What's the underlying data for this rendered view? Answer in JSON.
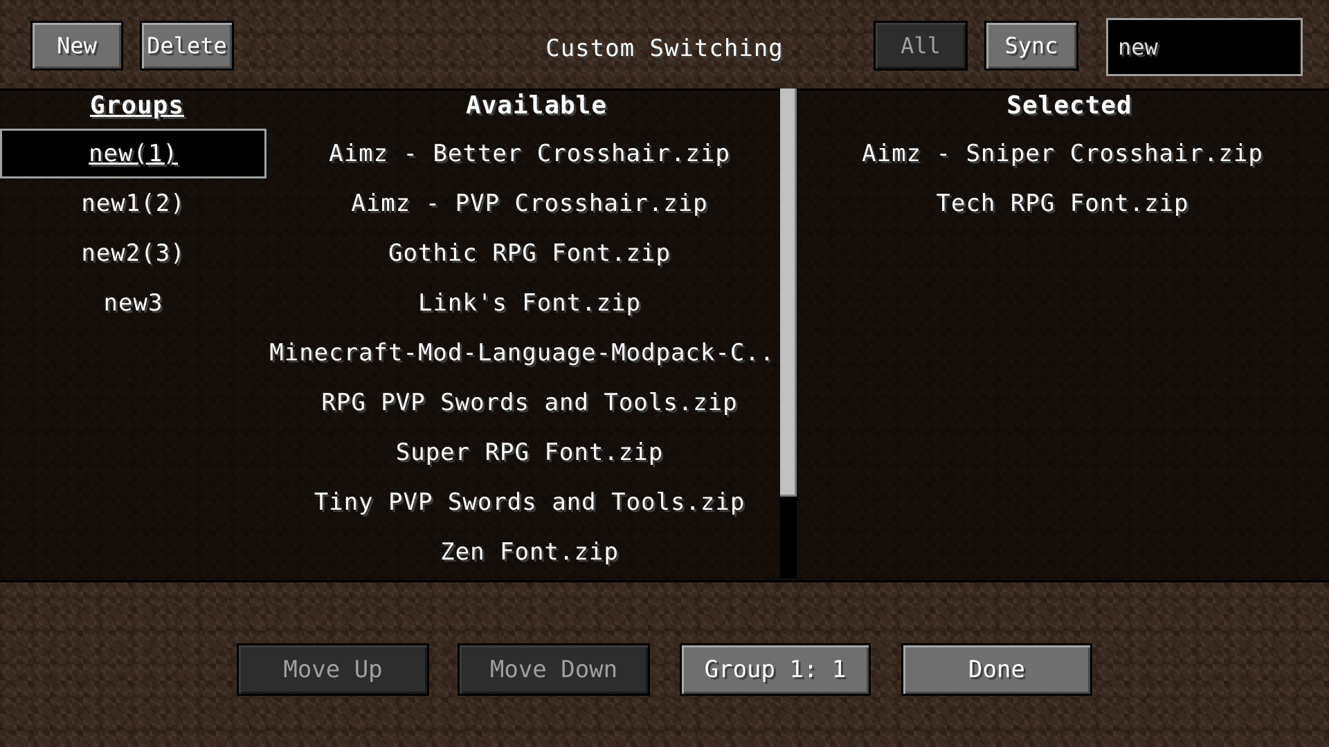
{
  "header": {
    "title": "Custom Switching",
    "new_label": "New",
    "delete_label": "Delete",
    "all_label": "All",
    "sync_label": "Sync",
    "search_value": "new"
  },
  "groups": {
    "header": "Groups",
    "items": [
      "new(1)",
      "new1(2)",
      "new2(3)",
      "new3"
    ],
    "selected_index": 0
  },
  "available": {
    "header": "Available",
    "items": [
      "Aimz - Better Crosshair.zip",
      "Aimz - PVP Crosshair.zip",
      "Gothic RPG Font.zip",
      "Link's Font.zip",
      "Minecraft-Mod-Language-Modpack-C...",
      "RPG PVP Swords and Tools.zip",
      "Super RPG Font.zip",
      "Tiny PVP Swords and Tools.zip",
      "Zen Font.zip"
    ]
  },
  "selected": {
    "header": "Selected",
    "items": [
      "Aimz - Sniper Crosshair.zip",
      "Tech RPG Font.zip"
    ]
  },
  "footer": {
    "move_up_label": "Move Up",
    "move_down_label": "Move Down",
    "group_label": "Group 1: 1",
    "done_label": "Done"
  },
  "colors": {
    "button": "#6f6f6f",
    "button_disabled": "#2d2d2d",
    "panel": "#0c0806",
    "text": "#ffffff"
  }
}
